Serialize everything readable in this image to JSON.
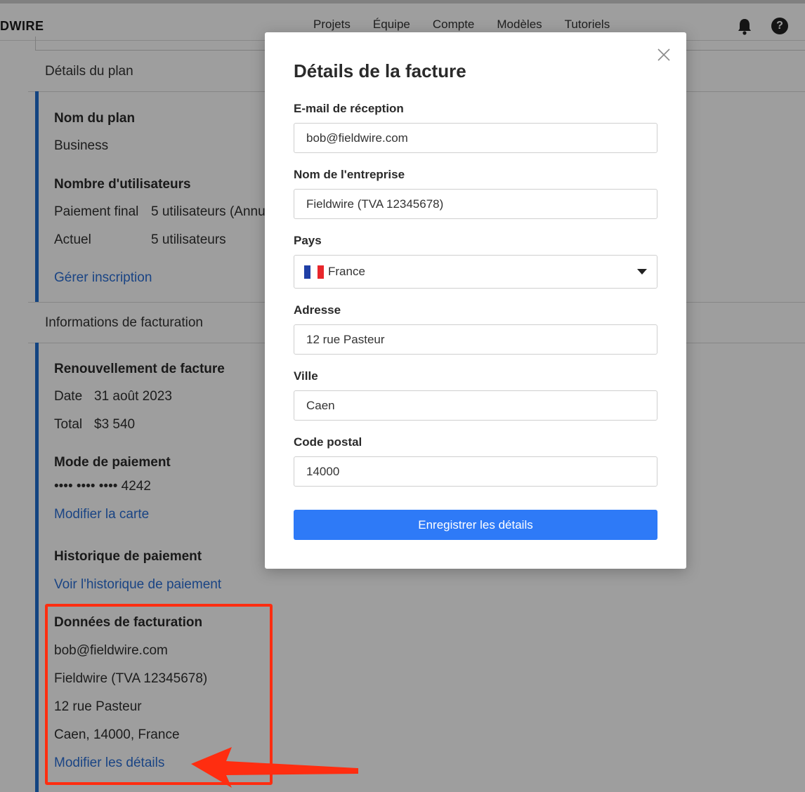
{
  "app": {
    "logo": "DWIRE"
  },
  "nav": {
    "items": [
      "Projets",
      "Équipe",
      "Compte",
      "Modèles",
      "Tutoriels"
    ]
  },
  "plan": {
    "section_title": "Détails du plan",
    "name_label": "Nom du plan",
    "name_value": "Business",
    "users_label": "Nombre d'utilisateurs",
    "final_payment_label": "Paiement final",
    "final_payment_value": "5 utilisateurs (Annu",
    "current_label": "Actuel",
    "current_value": "5 utilisateurs",
    "manage_link": "Gérer inscription"
  },
  "billing": {
    "section_title": "Informations de facturation",
    "renewal_label": "Renouvellement de facture",
    "date_label": "Date",
    "date_value": "31 août 2023",
    "total_label": "Total",
    "total_value": "$3 540",
    "payment_method_label": "Mode de paiement",
    "card_number": "•••• •••• •••• 4242",
    "edit_card_link": "Modifier la carte",
    "history_label": "Historique de paiement",
    "history_link": "Voir l'historique de paiement",
    "details_label": "Données de facturation",
    "details_email": "bob@fieldwire.com",
    "details_company": "Fieldwire (TVA 12345678)",
    "details_address": "12 rue Pasteur",
    "details_city": "Caen, 14000, France",
    "edit_details_link": "Modifier les détails"
  },
  "modal": {
    "title": "Détails de la facture",
    "email_label": "E-mail de réception",
    "email_value": "bob@fieldwire.com",
    "company_label": "Nom de l'entreprise",
    "company_value": "Fieldwire (TVA 12345678)",
    "country_label": "Pays",
    "country_value": "France",
    "address_label": "Adresse",
    "address_value": "12 rue Pasteur",
    "city_label": "Ville",
    "city_value": "Caen",
    "zip_label": "Code postal",
    "zip_value": "14000",
    "save_button": "Enregistrer les détails"
  },
  "colors": {
    "accent": "#2e7af7",
    "link": "#2a6fd6",
    "card_border": "#1f6fd1",
    "highlight": "#ff2d10"
  },
  "icons": {
    "notifications": "bell-icon",
    "help": "help-icon",
    "close": "close-icon",
    "dropdown": "caret-down-icon",
    "country_flag": "france-flag-icon"
  }
}
